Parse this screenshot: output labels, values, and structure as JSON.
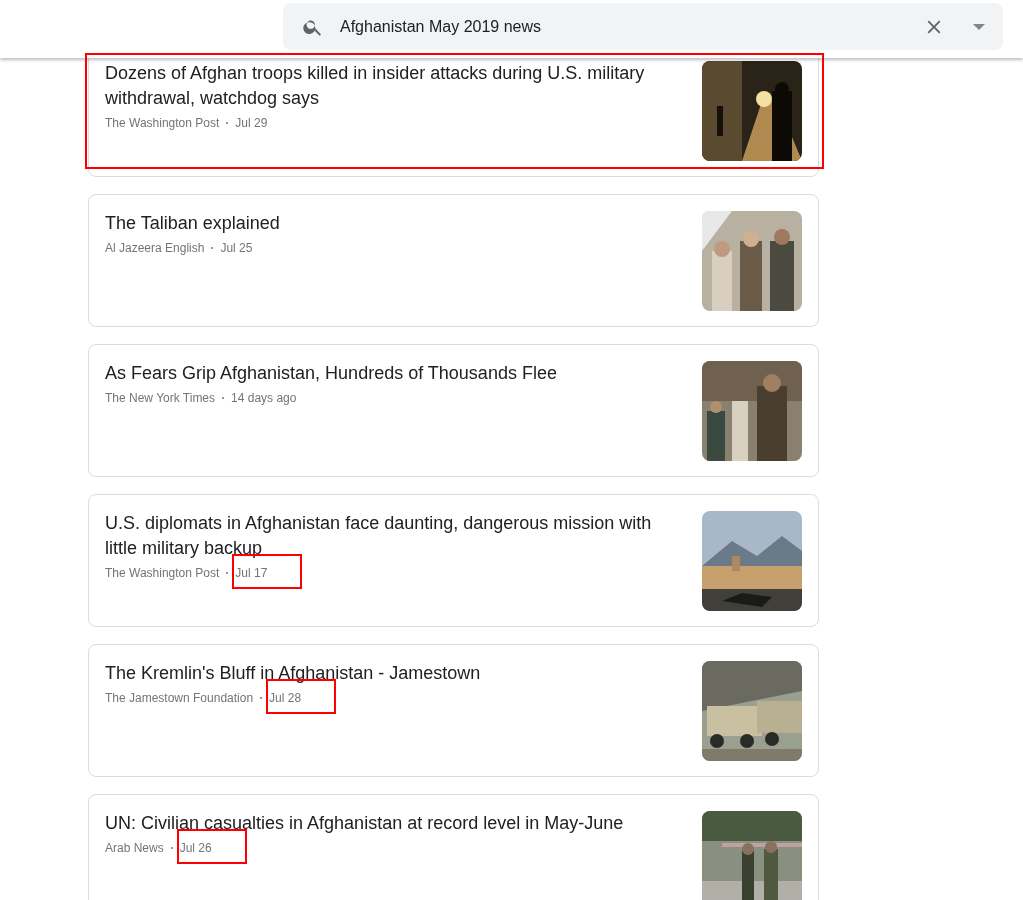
{
  "search": {
    "value": "Afghanistan May 2019 news"
  },
  "articles": [
    {
      "title": "Dozens of Afghan troops killed in insider attacks during U.S. military withdrawal, watchdog says",
      "source": "The Washington Post",
      "date": "Jul 29",
      "card_marked": true,
      "date_marked": false
    },
    {
      "title": "The Taliban explained",
      "source": "Al Jazeera English",
      "date": "Jul 25",
      "card_marked": false,
      "date_marked": false
    },
    {
      "title": "As Fears Grip Afghanistan, Hundreds of Thousands Flee",
      "source": "The New York Times",
      "date": "14 days ago",
      "card_marked": false,
      "date_marked": false
    },
    {
      "title": "U.S. diplomats in Afghanistan face daunting, dangerous mission with little military backup",
      "source": "The Washington Post",
      "date": "Jul 17",
      "card_marked": false,
      "date_marked": true
    },
    {
      "title": "The Kremlin's Bluff in Afghanistan - Jamestown",
      "source": "The Jamestown Foundation",
      "date": "Jul 28",
      "card_marked": false,
      "date_marked": true
    },
    {
      "title": "UN: Civilian casualties in Afghanistan at record level in May-June",
      "source": "Arab News",
      "date": "Jul 26",
      "card_marked": false,
      "date_marked": true
    }
  ]
}
